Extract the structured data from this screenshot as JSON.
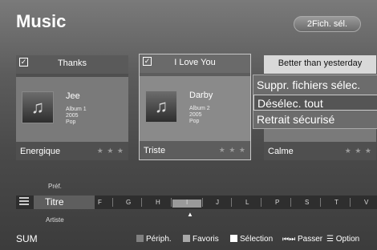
{
  "header": {
    "title": "Music",
    "selection_button": "2Fich. sél."
  },
  "cards": [
    {
      "checked": true,
      "title": "Thanks",
      "artist": "Jee",
      "album": "Album 1",
      "year": "2005",
      "genre": "Pop",
      "mood": "Energique",
      "stars": "★ ★ ★",
      "art_icon": "music-note-icon"
    },
    {
      "checked": true,
      "title": "I Love You",
      "artist": "Darby",
      "album": "Album 2",
      "year": "2005",
      "genre": "Pop",
      "mood": "Triste",
      "stars": "★ ★ ★",
      "art_icon": "music-note-icon"
    },
    {
      "checked": false,
      "title": "Better than yesterday",
      "mood": "Calme",
      "stars": "★ ★ ★"
    }
  ],
  "context_menu": {
    "items": [
      "Suppr. fichiers sélec.",
      "Désélec. tout",
      "Retrait sécurisé"
    ],
    "highlighted_index": 1
  },
  "sort": {
    "above": "Préf.",
    "current": "Titre",
    "below": "Artiste"
  },
  "index_bar": {
    "letters": [
      "F",
      "G",
      "H",
      "I",
      "J",
      "L",
      "P",
      "S",
      "T",
      "V"
    ],
    "selected": "I",
    "caret": "▲"
  },
  "footer": {
    "device": "SUM",
    "legend": [
      {
        "color": "#808080",
        "label": "Périph."
      },
      {
        "color": "#a9a9a9",
        "label": "Favoris"
      },
      {
        "color": "#ffffff",
        "label": "Sélection"
      },
      {
        "icon": "skip-icon",
        "glyph": "⏮⏭",
        "label": "Passer"
      },
      {
        "icon": "option-icon",
        "glyph": "☰",
        "label": "Option"
      }
    ]
  }
}
